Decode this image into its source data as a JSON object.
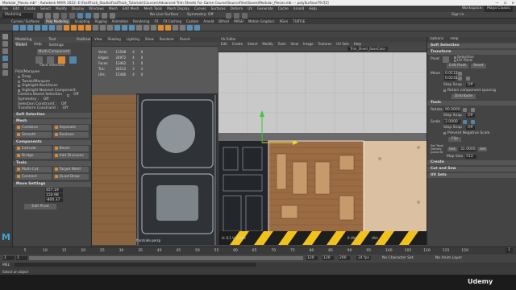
{
  "window": {
    "title": "Modular_Pieces.mb* - Autodesk MAYA 2022: E:\\FastTrack_Studio\\FastTrack_Tutorials\\Courses\\Advanced Trim Sheets For Game Course\\SourceFiles\\Saves\\Modular_Pieces.mb  ---  polySurface79.f[2]"
  },
  "menubar": {
    "items": [
      "File",
      "Edit",
      "Create",
      "Select",
      "Modify",
      "Display",
      "Windows",
      "Mesh",
      "Edit Mesh",
      "Mesh Tools",
      "Mesh Display",
      "Curves",
      "Surfaces",
      "Deform",
      "UV",
      "Generate",
      "Cache",
      "Arnold",
      "Help"
    ],
    "workspace_label": "Workspace:",
    "workspace_value": "Maya Classic"
  },
  "statusline": {
    "mode": "Modeling",
    "live_surface": "No Live Surface",
    "symmetry": "Symmetry: Off",
    "sign_in": "Sign In"
  },
  "shelf": {
    "tabs": [
      "Curves / Surfaces",
      "Poly Modeling",
      "Sculpting",
      "Rigging",
      "Animation",
      "Rendering",
      "FX",
      "FX Caching",
      "Custom",
      "Arnold",
      "Bifrost",
      "MASH",
      "Motion Graphics",
      "XGen",
      "TURTLE"
    ],
    "active_tab": "Poly Modeling"
  },
  "modeling_toolkit": {
    "tabs": [
      "Modeling Toolkit",
      "Tool Settings",
      "Outliner"
    ],
    "menu": [
      "Object",
      "Help"
    ],
    "multi_component_button": "Multi-Component",
    "face_selected": "Face selected",
    "pick_marquee_label": "Pick/Marquee",
    "options": [
      {
        "label": "Drag",
        "checked": false
      },
      {
        "label": "Tweak/Marquee",
        "checked": false
      },
      {
        "label": "Highlight Backfaces",
        "checked": true
      },
      {
        "label": "Highlight Nearest Component",
        "checked": true
      }
    ],
    "camera_based_selection": "Camera Based Selection",
    "camera_based_value": "Off",
    "symmetry_label": "Symmetry :",
    "symmetry_value": "Off",
    "selection_constraint_label": "Selection Constraint :",
    "selection_constraint_value": "Off",
    "transform_constraint_label": "Transform Constraint :",
    "transform_constraint_value": "Off",
    "soft_selection": "Soft Selection",
    "mesh_section": "Mesh",
    "mesh_buttons": [
      "Combine",
      "Separate",
      "Smooth",
      "Boolean"
    ],
    "components_section": "Components",
    "component_buttons": [
      "Extrude",
      "Bevel",
      "Bridge",
      "Add Divisions"
    ],
    "tools_section": "Tools",
    "tool_buttons": [
      "Multi-Cut",
      "Target Weld",
      "Connect",
      "Quad Draw"
    ],
    "move_settings_section": "Move Settings",
    "move_values": [
      "457.19",
      "150.98",
      "-800.37"
    ],
    "edit_pivot_button": "Edit Pivot"
  },
  "viewport": {
    "menu": [
      "View",
      "Shading",
      "Lighting",
      "Show",
      "Renderer",
      "Panels"
    ],
    "hud": [
      {
        "label": "Verts:",
        "v1": "13508",
        "v2": "4",
        "v3": "0"
      },
      {
        "label": "Edges:",
        "v1": "26972",
        "v2": "4",
        "v3": "0"
      },
      {
        "label": "Faces:",
        "v1": "13462",
        "v2": "1",
        "v3": "0"
      },
      {
        "label": "Tris:",
        "v1": "26112",
        "v2": "2",
        "v3": "2"
      },
      {
        "label": "UVs:",
        "v1": "15486",
        "v2": "4",
        "v3": "0"
      }
    ],
    "camera_label": "frontside   persp"
  },
  "uv_editor": {
    "title": "UV Editor",
    "menu": [
      "Edit",
      "Create",
      "Select",
      "Modify",
      "Tools",
      "View",
      "Image",
      "Textures",
      "UV Sets",
      "Help"
    ],
    "texture_label": "Trim_Sheet_BaseColor",
    "readout": "U: 0.1  V: 0.229",
    "uv_space": "UV Space",
    "uv_count_1": "0 UVs",
    "uv_count_2": "UVs"
  },
  "uv_toolkit": {
    "tabs": [
      "Options",
      "Help"
    ],
    "soft_selection": "Soft Selection",
    "transform_section": "Transform",
    "pivot_label": "Pivot",
    "pivot_options": [
      "Selection",
      "UV Point"
    ],
    "edit_pivot_button": "Edit Pivot",
    "reset_button": "Reset",
    "move_label": "Move",
    "move_u": "0.0112",
    "move_v": "0.0231",
    "step_snap_label": "Step Snap :",
    "step_snap_value": "Off",
    "retain_spacing": "Retain component spacing",
    "distribute_button": "Distribute",
    "rotate_label": "Rotate",
    "rotate_value": "90.0000",
    "rotate_step_snap": "Off",
    "scale_label": "Scale",
    "scale_value": "2.0000",
    "scale_step_snap": "Off",
    "prevent_negative_scale": "Prevent Negative Scale",
    "flip_button": "Flip",
    "tools_section": "Tools",
    "set_texel_label": "Set Texel Density (px/unit)",
    "get_button": "Get",
    "texel_value": "32.0000",
    "set_button": "Set",
    "map_size_label": "Map Size",
    "map_size_value": "512",
    "create_section": "Create",
    "cut_sew_section": "Cut and Sew",
    "uv_sets_section": "UV Sets"
  },
  "timeline": {
    "ticks": [
      "5",
      "10",
      "15",
      "20",
      "25",
      "30",
      "35",
      "40",
      "45",
      "50",
      "55",
      "60",
      "65",
      "70",
      "75",
      "80",
      "85",
      "90",
      "95",
      "100",
      "105",
      "110",
      "115",
      "120"
    ],
    "current_frame": "1"
  },
  "range": {
    "start": "1",
    "start_inner": "1",
    "end_inner": "120",
    "end": "120",
    "end_outer": "200",
    "fps": "24 fps",
    "character_set": "No Character Set",
    "anim_layer": "No Anim Layer"
  },
  "cmdline": {
    "lang": "MEL"
  },
  "helpline": {
    "text": "Select an object"
  },
  "watermark": "Udemy",
  "colors": {
    "maya_bg": "#444444",
    "accent": "#5285a6",
    "hazard_yellow": "#f2c21b",
    "copper": "#9b6b43",
    "concrete": "#c8c8c8"
  }
}
